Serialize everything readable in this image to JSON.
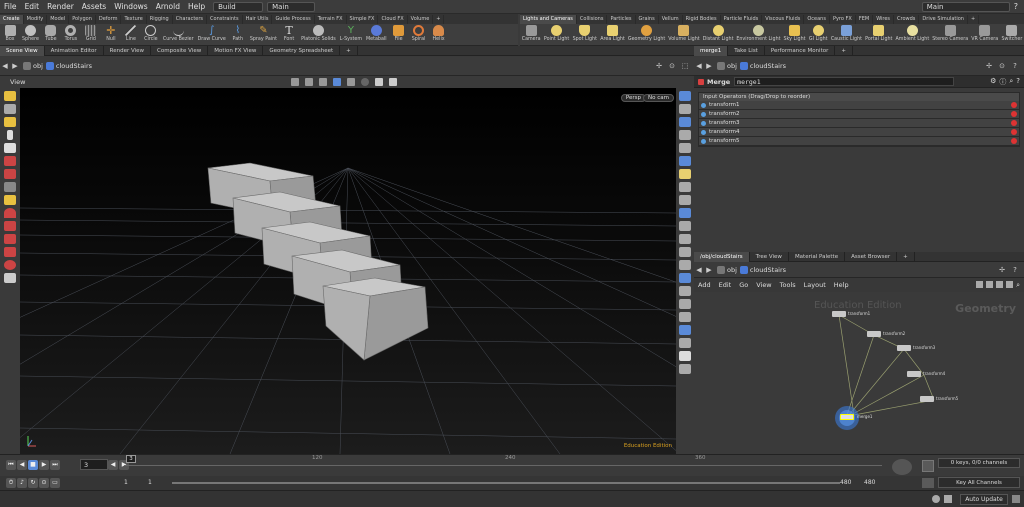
{
  "menu": {
    "items": [
      "File",
      "Edit",
      "Render",
      "Assets",
      "Windows",
      "Arnold",
      "Help"
    ],
    "desktop": "Build",
    "context": "Main",
    "right_desktop": "Main"
  },
  "shelf_tabs_left": [
    "Create",
    "Modify",
    "Model",
    "Polygon",
    "Deform",
    "Texture",
    "Rigging",
    "Characters",
    "Constraints",
    "Hair Utils",
    "Guide Process",
    "Terrain FX",
    "Simple FX",
    "Cloud FX",
    "Volume"
  ],
  "shelf_tabs_right": [
    "Lights and Cameras",
    "Collisions",
    "Particles",
    "Grains",
    "Vellum",
    "Rigid Bodies",
    "Particle Fluids",
    "Viscous Fluids",
    "Oceans",
    "Pyro FX",
    "FEM",
    "Wires",
    "Crowds",
    "Drive Simulation"
  ],
  "tools_left": [
    "Box",
    "Sphere",
    "Tube",
    "Torus",
    "Grid",
    "Null",
    "Line",
    "Circle",
    "Curve Bezier",
    "Draw Curve",
    "Path",
    "Spray Paint",
    "Font",
    "Platonic Solids",
    "L-System",
    "Metaball",
    "File",
    "Spiral",
    "Helix"
  ],
  "tools_right": [
    "Camera",
    "Point Light",
    "Spot Light",
    "Area Light",
    "Geometry Light",
    "Volume Light",
    "Distant Light",
    "Environment Light",
    "Sky Light",
    "GI Light",
    "Caustic Light",
    "Portal Light",
    "Ambient Light",
    "Stereo Camera",
    "VR Camera",
    "Switcher"
  ],
  "pane_tabs_left": [
    "Scene View",
    "Animation Editor",
    "Render View",
    "Composite View",
    "Motion FX View",
    "Geometry Spreadsheet"
  ],
  "pane_tabs_right_top": [
    "merge1",
    "Take List",
    "Performance Monitor"
  ],
  "pane_tabs_right_bottom": [
    "/obj/cloudStairs",
    "Tree View",
    "Material Palette",
    "Asset Browser"
  ],
  "path": {
    "root": "obj",
    "node": "cloudStairs"
  },
  "viewport": {
    "label": "View",
    "persp": "Persp",
    "cam": "No cam",
    "watermark": "Education Edition"
  },
  "params": {
    "type": "Merge",
    "name": "merge1",
    "section": "Input Operators (Drag/Drop to reorder)",
    "inputs": [
      "transform1",
      "transform2",
      "transform3",
      "transform4",
      "transform5"
    ]
  },
  "network": {
    "menus": [
      "Add",
      "Edit",
      "Go",
      "View",
      "Tools",
      "Layout",
      "Help"
    ],
    "edition": "Education Edition",
    "context": "Geometry",
    "nodes": [
      {
        "name": "transform1"
      },
      {
        "name": "transform2"
      },
      {
        "name": "transform3"
      },
      {
        "name": "transform4"
      },
      {
        "name": "transform5"
      },
      {
        "name": "merge1"
      }
    ]
  },
  "timeline": {
    "current_frame": "3",
    "frame_marker": "3",
    "ticks": [
      "120",
      "240",
      "360"
    ],
    "start": "1",
    "start2": "1",
    "end": "480",
    "end2": "480",
    "keys_info": "0 keys, 0/0 channels",
    "key_all": "Key All Channels"
  },
  "status": {
    "auto_update": "Auto Update"
  }
}
